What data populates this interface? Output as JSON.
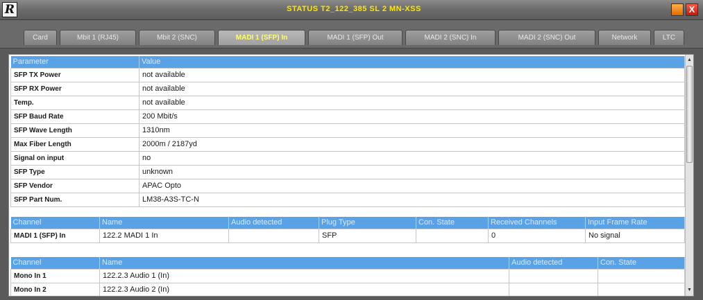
{
  "window": {
    "title": "STATUS T2_122_385 SL 2 MN-XSS",
    "logo": "R",
    "close_label": "X"
  },
  "tabs": [
    {
      "label": "Card"
    },
    {
      "label": "Mbit 1 (RJ45)"
    },
    {
      "label": "Mbit 2 (SNC)"
    },
    {
      "label": "MADI 1 (SFP) In",
      "active": true
    },
    {
      "label": "MADI 1 (SFP) Out"
    },
    {
      "label": "MADI 2 (SNC) In"
    },
    {
      "label": "MADI 2 (SNC) Out"
    },
    {
      "label": "Network"
    },
    {
      "label": "LTC"
    }
  ],
  "params_table": {
    "headers": [
      "Parameter",
      "Value"
    ],
    "rows": [
      [
        "SFP TX Power",
        "not available"
      ],
      [
        "SFP RX Power",
        "not available"
      ],
      [
        "Temp.",
        "not available"
      ],
      [
        "SFP Baud Rate",
        "200 Mbit/s"
      ],
      [
        "SFP Wave Length",
        "1310nm"
      ],
      [
        "Max Fiber Length",
        "2000m / 2187yd"
      ],
      [
        "Signal on input",
        "no"
      ],
      [
        "SFP Type",
        "unknown"
      ],
      [
        "SFP Vendor",
        "APAC Opto"
      ],
      [
        "SFP Part Num.",
        "LM38-A3S-TC-N"
      ]
    ]
  },
  "madi_table": {
    "headers": [
      "Channel",
      "Name",
      "Audio detected",
      "Plug Type",
      "Con. State",
      "Received Channels",
      "Input Frame Rate"
    ],
    "rows": [
      [
        "MADI 1 (SFP) In",
        "122.2 MADI 1 In",
        "",
        "SFP",
        "",
        "0",
        "No signal"
      ]
    ]
  },
  "mono_table": {
    "headers": [
      "Channel",
      "Name",
      "Audio detected",
      "Con. State"
    ],
    "rows": [
      [
        "Mono In 1",
        "122.2.3 Audio 1 (In)",
        "",
        ""
      ],
      [
        "Mono In 2",
        "122.2.3 Audio 2 (In)",
        "",
        ""
      ]
    ]
  },
  "icons": {
    "scroll_up": "triangle-up",
    "scroll_down": "triangle-down"
  }
}
